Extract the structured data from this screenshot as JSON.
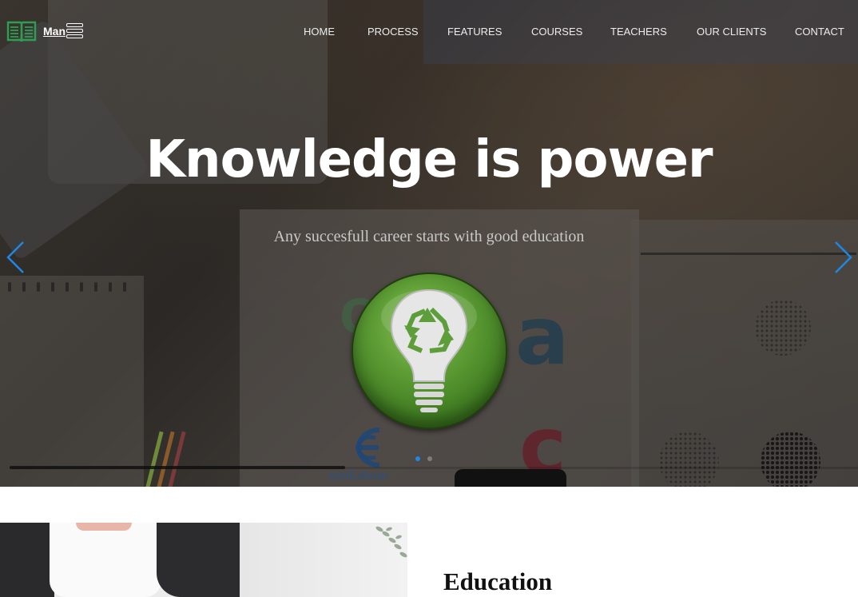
{
  "nav": {
    "brand": "Man",
    "items": [
      {
        "label": "HOME"
      },
      {
        "label": "PROCESS"
      },
      {
        "label": "FEATURES"
      },
      {
        "label": "COURSES"
      },
      {
        "label": "TEACHERS"
      },
      {
        "label": "OUR CLIENTS"
      },
      {
        "label": "CONTACT"
      }
    ],
    "icons": {
      "logo": "open-book-icon",
      "toggle": "hamburger-menu-icon"
    }
  },
  "hero": {
    "title": "Knowledge is power",
    "subtitle": "Any succesfull career starts with good education",
    "badge_icon": "recycle-lightbulb-icon",
    "prev_icon": "chevron-left-icon",
    "next_icon": "chevron-right-icon",
    "slides_total": 2,
    "active_slide": 1,
    "background_logo_text": "conEdison",
    "colors": {
      "accent": "#1e88e5",
      "logo_green": "#2e9e52",
      "badge_green": "#4f8f2b"
    }
  },
  "about": {
    "title": "Education"
  }
}
